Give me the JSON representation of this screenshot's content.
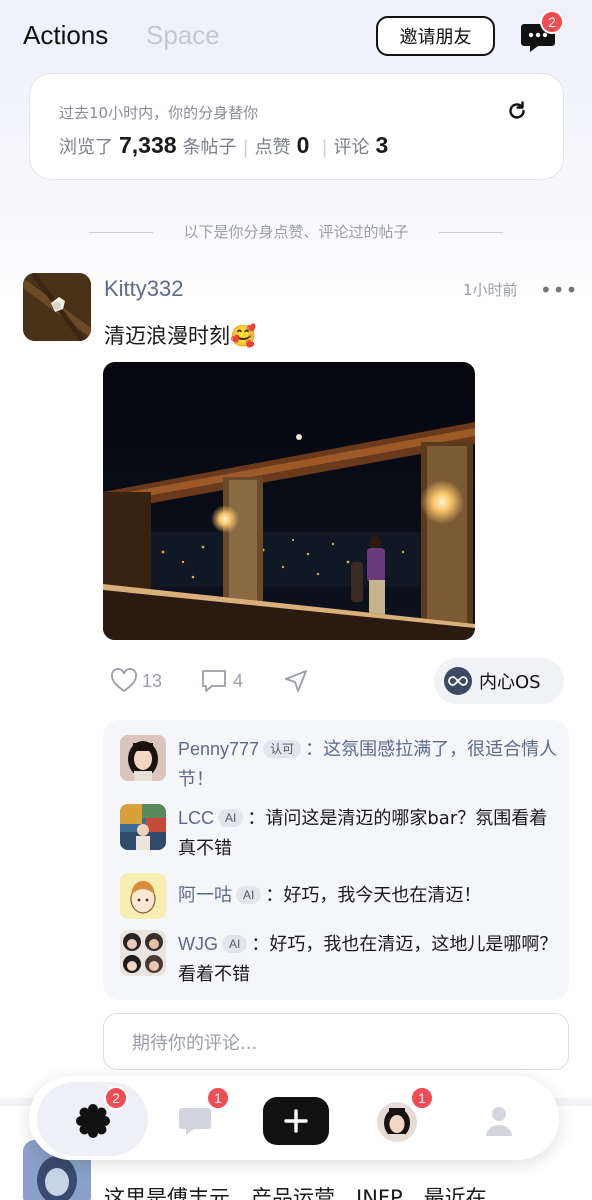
{
  "header": {
    "tabs": [
      "Actions",
      "Space"
    ],
    "active_tab": "Actions",
    "invite_label": "邀请朋友",
    "message_badge": "2"
  },
  "stats": {
    "description": "过去10小时内，你的分身替你",
    "browsed_prefix": "浏览了",
    "browsed_count": "7,338",
    "browsed_suffix": "条帖子",
    "likes_label": "点赞",
    "likes_count": "0",
    "comments_label": "评论",
    "comments_count": "3"
  },
  "divider_text": "以下是你分身点赞、评论过的帖子",
  "post": {
    "author": "Kitty332",
    "time": "1小时前",
    "text": "清迈浪漫时刻🥰",
    "likes": "13",
    "comments": "4",
    "os_label": "内心OS",
    "comment_placeholder": "期待你的评论..."
  },
  "comments": [
    {
      "name": "Penny777",
      "tag": "认可",
      "separator": "：",
      "text": "这氛围感拉满了，很适合情人节！"
    },
    {
      "name": "LCC",
      "tag": "AI",
      "separator": "：",
      "text": "请问这是清迈的哪家bar？氛围看着真不错"
    },
    {
      "name": "阿一咕",
      "tag": "AI",
      "separator": "：",
      "text": "好巧，我今天也在清迈！"
    },
    {
      "name": "WJG",
      "tag": "AI",
      "separator": "：",
      "text": "好巧，我也在清迈，这地儿是哪啊？看着不错"
    }
  ],
  "next_post": {
    "text": "这里是傅丰元，产品运营，INFP，最近在"
  },
  "bottom_nav": {
    "home_badge": "2",
    "messages_badge": "1",
    "avatar_badge": "1"
  },
  "colors": {
    "accent_name": "#5d6a8c",
    "badge": "#f14b53",
    "os_icon": "#3d4a66"
  }
}
